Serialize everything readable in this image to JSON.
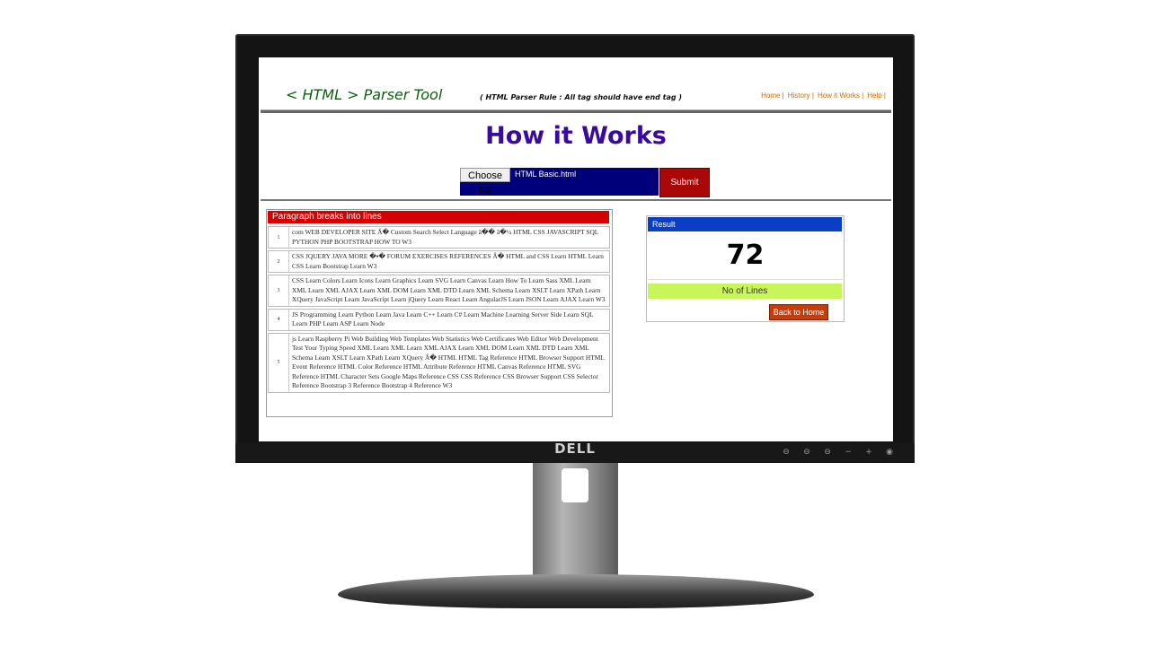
{
  "monitor": {
    "brand": "DELL",
    "control_glyphs": [
      "⊖",
      "⊖",
      "⊖",
      "−",
      "+",
      "◉"
    ]
  },
  "header": {
    "title": "< HTML > Parser Tool",
    "rule_note": "( HTML Parser Rule : All tag should have end tag )",
    "nav": [
      {
        "label": "Home |"
      },
      {
        "label": "History |"
      },
      {
        "label": "How it Works |"
      },
      {
        "label": "Help |"
      }
    ]
  },
  "page_title": "How it Works",
  "upload": {
    "choose_label": "Choose file",
    "file_name": "HTML Basic.html",
    "submit_label": "Submit"
  },
  "paragraphs": {
    "heading": "Paragraph breaks into lines",
    "rows": [
      {
        "num": "1",
        "text": "com WEB DEVELOPER SITE Â�   Custom Search Select Language â�� â�¼ HTML CSS JAVASCRIPT SQL PYTHON PHP BOOTSTRAP HOW TO W3"
      },
      {
        "num": "2",
        "text": "CSS JQUERY JAVA MORE �▪� FORUM EXERCISES REFERENCES Â� HTML and CSS Learn HTML Learn CSS Learn Bootstrap Learn W3"
      },
      {
        "num": "3",
        "text": "CSS Learn Colors Learn Icons Learn Graphics Learn SVG Learn Canvas Learn How To Learn Sass XML Learn XML Learn XML AJAX Learn XML DOM Learn XML DTD Learn XML Schema Learn XSLT Learn XPath Learn XQuery JavaScript Learn JavaScript Learn jQuery Learn React Learn AngularJS Learn JSON Learn AJAX Learn W3"
      },
      {
        "num": "4",
        "text": "JS Programming Learn Python Learn Java Learn C++ Learn C# Learn Machine Learning Server Side Learn SQL Learn PHP Learn ASP Learn Node"
      },
      {
        "num": "5",
        "text": "js Learn Raspberry Pi Web Building Web Templates Web Statistics Web Certificates Web Editor Web Development Test Your Typing Speed XML Learn XML Learn XML AJAX Learn XML DOM Learn XML DTD Learn XML Schema Learn XSLT Learn XPath Learn XQuery Â� HTML HTML Tag Reference HTML Browser Support HTML Event Reference HTML Color Reference HTML Attribute Reference HTML Canvas Reference HTML SVG Reference HTML Character Sets Google Maps Reference CSS CSS Reference CSS Browser Support CSS Selector Reference Bootstrap 3 Reference Bootstrap 4 Reference W3"
      }
    ]
  },
  "result": {
    "heading": "Result",
    "value": "72",
    "label": "No of Lines",
    "back_label": "Back to Home"
  }
}
